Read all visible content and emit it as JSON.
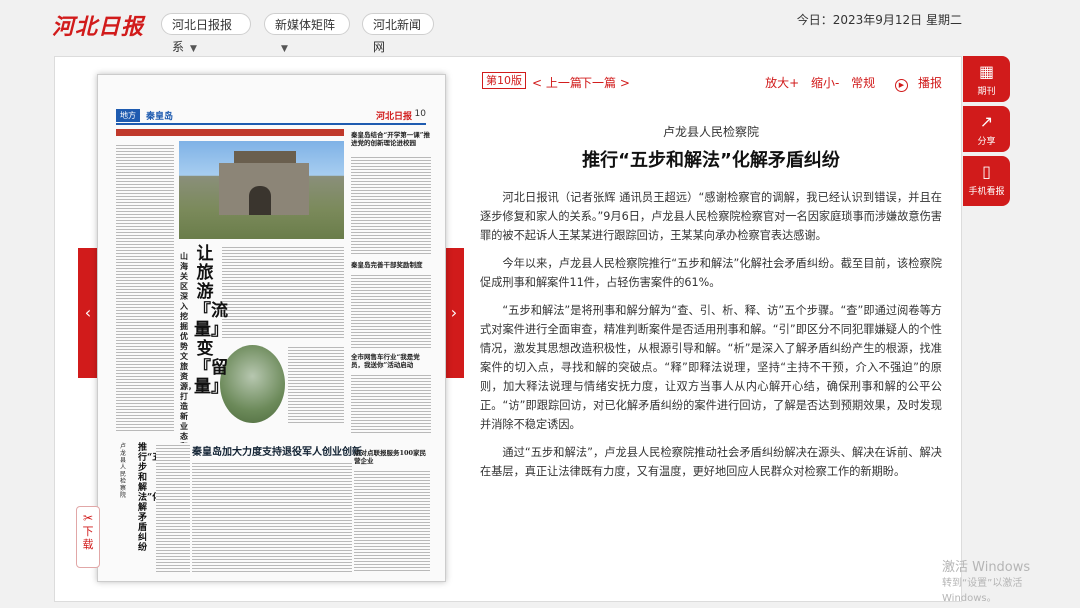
{
  "header": {
    "logo": "河北日报",
    "nav": [
      {
        "label": "河北日报报系",
        "dropdown": true
      },
      {
        "label": "新媒体矩阵",
        "dropdown": true
      },
      {
        "label": "河北新闻网",
        "dropdown": false
      }
    ],
    "date": "今日：2023年9月12日 星期二"
  },
  "newspaper_page": {
    "section_tag": "地方",
    "section_name": "秦皇岛",
    "logo": "河北日报",
    "page_number": "10",
    "main_headline": "让旅游『流量』变『留量』",
    "sub_headline": "山海关区深入挖掘优势文旅资源，打造新业态和消费场景",
    "right_headline_1": "秦皇岛结合“开学第一课”推进党的创新理论进校园",
    "right_headline_2": "秦皇岛完善干部奖励制度",
    "right_headline_3": "全市网售车行业“我是党员，我送你”活动启动",
    "bottom_headline": "秦皇岛加大力度支持退役军人创业创新",
    "bottom_right_headline": "点对点联报服务100家民营企业",
    "bottom_left_headline": "推行“五步和解法”化解矛盾纠纷",
    "bottom_left_subhead": "卢龙县人民检察院"
  },
  "controls": {
    "prev_page_arrow": "‹",
    "next_page_arrow": "›",
    "download_label": "下载"
  },
  "article": {
    "edition": "第10版",
    "prev": "< 上一篇",
    "next": "下一篇 >",
    "zoom_in": "放大+",
    "zoom_out": "缩小-",
    "normal": "常规",
    "play": "播报",
    "subtitle": "卢龙县人民检察院",
    "title": "推行“五步和解法”化解矛盾纠纷",
    "paragraphs": [
      "河北日报讯（记者张辉 通讯员王超远）“感谢检察官的调解，我已经认识到错误，并且在逐步修复和家人的关系。”9月6日，卢龙县人民检察院检察官对一名因家庭琐事而涉嫌故意伤害罪的被不起诉人王某某进行跟踪回访，王某某向承办检察官表达感谢。",
      "今年以来，卢龙县人民检察院推行“五步和解法”化解社会矛盾纠纷。截至目前，该检察院促成刑事和解案件11件，占轻伤害案件的61%。",
      "“五步和解法”是将刑事和解分解为“查、引、析、释、访”五个步骤。“查”即通过阅卷等方式对案件进行全面审查，精准判断案件是否适用刑事和解。“引”即区分不同犯罪嫌疑人的个性情况，激发其思想改造积极性，从根源引导和解。“析”是深入了解矛盾纠纷产生的根源，找准案件的切入点，寻找和解的突破点。“释”即释法说理，坚持“主持不干预，介入不强迫”的原则，加大释法说理与情绪安抚力度，让双方当事人从内心解开心结，确保刑事和解的公平公正。“访”即跟踪回访，对已化解矛盾纠纷的案件进行回访，了解是否达到预期效果，及时发现并消除不稳定诱因。",
      "通过“五步和解法”，卢龙县人民检察院推动社会矛盾纠纷解决在源头、解决在诉前、解决在基层，真正让法律既有力度，又有温度，更好地回应人民群众对检察工作的新期盼。"
    ]
  },
  "right_sidebar": [
    {
      "label": "期刊",
      "icon": "calendar-icon"
    },
    {
      "label": "分享",
      "icon": "share-icon"
    },
    {
      "label": "手机看报",
      "icon": "mobile-icon"
    }
  ],
  "watermark": {
    "line1": "激活 Windows",
    "line2": "转到“设置”以激活 Windows。"
  }
}
